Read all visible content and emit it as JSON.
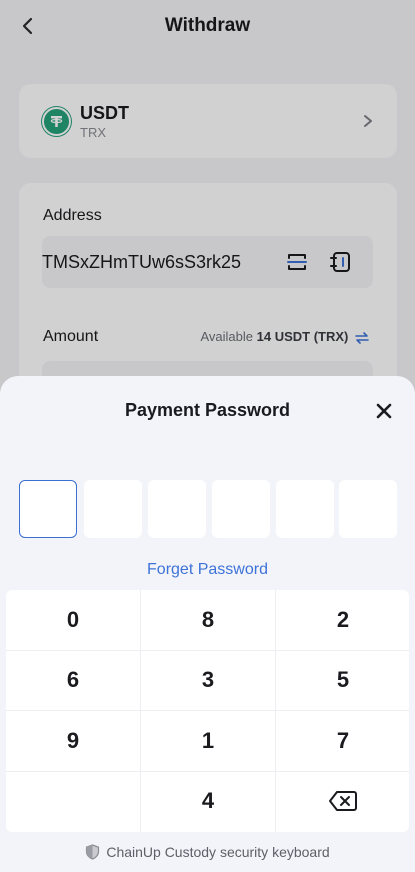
{
  "header": {
    "title": "Withdraw"
  },
  "asset": {
    "symbol": "USDT",
    "network": "TRX"
  },
  "form": {
    "address_label": "Address",
    "address_value": "TMSxZHmTUw6sS3rk25",
    "amount_label": "Amount",
    "available_prefix": "Available",
    "available_amount": "14 USDT (TRX)"
  },
  "password_sheet": {
    "title": "Payment Password",
    "pin_length": 6,
    "forget_label": "Forget Password"
  },
  "keypad": {
    "keys": [
      "0",
      "8",
      "2",
      "6",
      "3",
      "5",
      "9",
      "1",
      "7",
      "",
      "4",
      "backspace-icon"
    ]
  },
  "footer": {
    "note": "ChainUp Custody security keyboard"
  },
  "colors": {
    "accent": "#3d73d8",
    "tether_green": "#26a17b",
    "sheet_bg": "#f3f4f9"
  }
}
